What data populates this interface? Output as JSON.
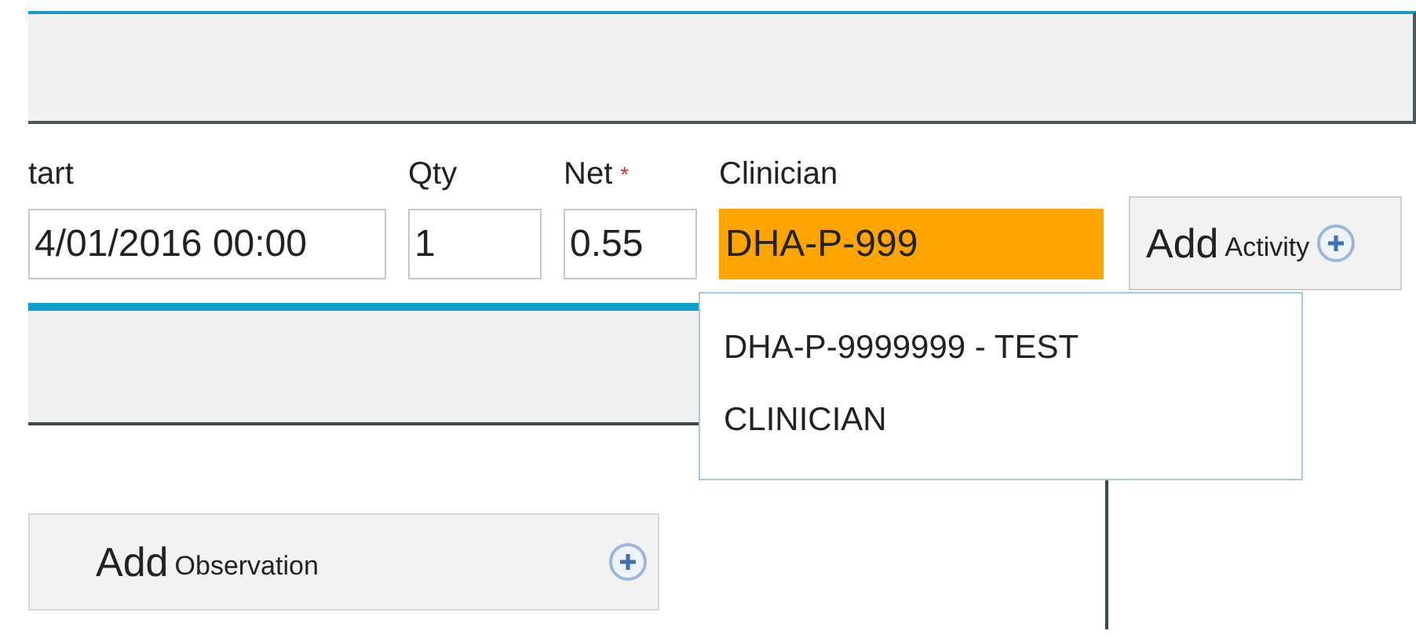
{
  "fields": [
    {
      "label": "tart",
      "value": "4/01/2016 00:00",
      "required": false,
      "highlighted": false
    },
    {
      "label": "Qty",
      "value": "1",
      "required": false,
      "highlighted": false
    },
    {
      "label": "Net",
      "value": "0.55",
      "required": true,
      "highlighted": false
    },
    {
      "label": "Clinician",
      "value": "DHA-P-999",
      "required": false,
      "highlighted": true
    }
  ],
  "required_mark": "*",
  "activity_button": {
    "label_main": "Add",
    "label_sub": "Activity"
  },
  "suggestions": [
    {
      "text": "DHA-P-9999999 - TEST CLINICIAN"
    }
  ],
  "observation_button": {
    "label_main": "Add",
    "label_sub": "Observation"
  }
}
